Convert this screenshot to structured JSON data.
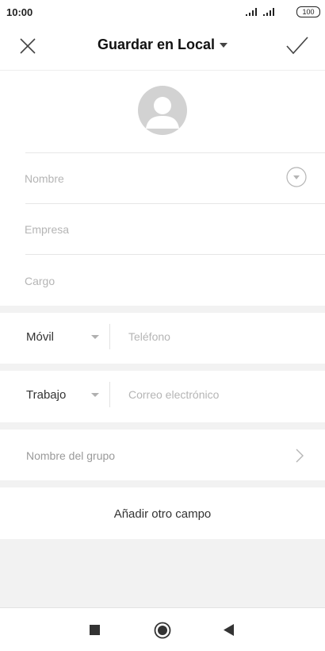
{
  "status_bar": {
    "time": "10:00",
    "battery": "100"
  },
  "header": {
    "title": "Guardar en Local"
  },
  "form": {
    "name_placeholder": "Nombre",
    "company_placeholder": "Empresa",
    "title_placeholder": "Cargo",
    "phone_type": "Móvil",
    "phone_placeholder": "Teléfono",
    "email_type": "Trabajo",
    "email_placeholder": "Correo electrónico",
    "group_label": "Nombre del grupo",
    "add_field_label": "Añadir otro campo"
  },
  "icons": {
    "close": "close-icon",
    "confirm": "check-icon",
    "avatar": "avatar-icon",
    "expand": "chevron-down-circle-icon",
    "group_arrow": "chevron-right-icon",
    "nav_recent": "square-icon",
    "nav_home": "circle-icon",
    "nav_back": "triangle-back-icon"
  }
}
